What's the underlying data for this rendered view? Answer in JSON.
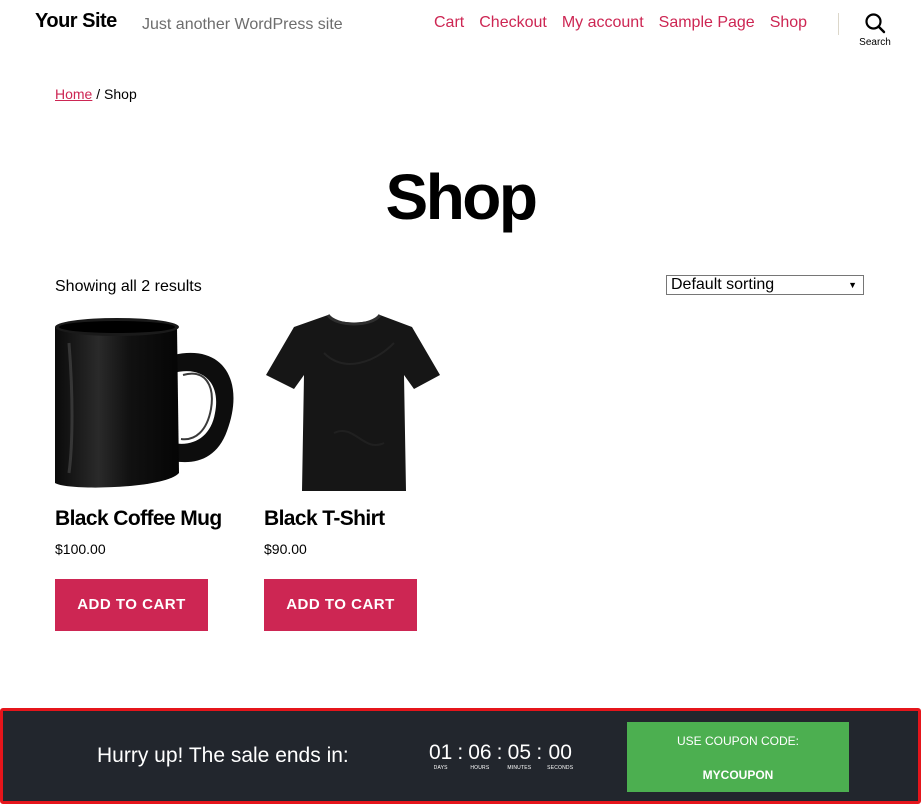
{
  "header": {
    "site_title": "Your Site",
    "tagline": "Just another WordPress site",
    "nav": [
      "Cart",
      "Checkout",
      "My account",
      "Sample Page",
      "Shop"
    ],
    "search_label": "Search",
    "accent_color": "#cd2653"
  },
  "breadcrumb": {
    "home": "Home",
    "separator": " / ",
    "current": "Shop"
  },
  "page": {
    "title": "Shop",
    "result_count": "Showing all 2 results",
    "sort_selected": "Default sorting"
  },
  "products": [
    {
      "name": "Black Coffee Mug",
      "price": "$100.00",
      "button": "ADD TO CART",
      "image_icon": "mug-image"
    },
    {
      "name": "Black T-Shirt",
      "price": "$90.00",
      "button": "ADD TO CART",
      "image_icon": "tshirt-image"
    }
  ],
  "sale_bar": {
    "message": "Hurry up! The sale ends in:",
    "countdown": [
      {
        "value": "01",
        "label": "DAYS"
      },
      {
        "value": "06",
        "label": "HOURS"
      },
      {
        "value": "05",
        "label": "MINUTES"
      },
      {
        "value": "00",
        "label": "SECONDS"
      }
    ],
    "separator": ":",
    "coupon_label": "USE COUPON CODE:",
    "coupon_code": "MYCOUPON",
    "bar_color": "#22262d",
    "coupon_color": "#4caf50",
    "border_color": "#e5151b"
  }
}
